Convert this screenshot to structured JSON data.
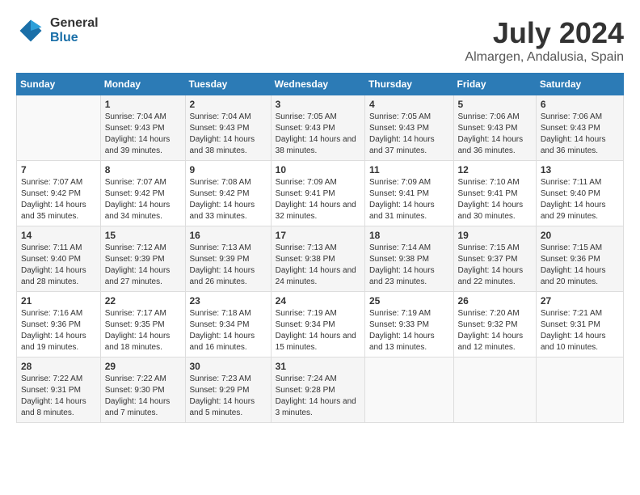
{
  "logo": {
    "line1": "General",
    "line2": "Blue"
  },
  "title": "July 2024",
  "location": "Almargen, Andalusia, Spain",
  "days_header": [
    "Sunday",
    "Monday",
    "Tuesday",
    "Wednesday",
    "Thursday",
    "Friday",
    "Saturday"
  ],
  "weeks": [
    [
      {
        "day": "",
        "sunrise": "",
        "sunset": "",
        "daylight": ""
      },
      {
        "day": "1",
        "sunrise": "Sunrise: 7:04 AM",
        "sunset": "Sunset: 9:43 PM",
        "daylight": "Daylight: 14 hours and 39 minutes."
      },
      {
        "day": "2",
        "sunrise": "Sunrise: 7:04 AM",
        "sunset": "Sunset: 9:43 PM",
        "daylight": "Daylight: 14 hours and 38 minutes."
      },
      {
        "day": "3",
        "sunrise": "Sunrise: 7:05 AM",
        "sunset": "Sunset: 9:43 PM",
        "daylight": "Daylight: 14 hours and 38 minutes."
      },
      {
        "day": "4",
        "sunrise": "Sunrise: 7:05 AM",
        "sunset": "Sunset: 9:43 PM",
        "daylight": "Daylight: 14 hours and 37 minutes."
      },
      {
        "day": "5",
        "sunrise": "Sunrise: 7:06 AM",
        "sunset": "Sunset: 9:43 PM",
        "daylight": "Daylight: 14 hours and 36 minutes."
      },
      {
        "day": "6",
        "sunrise": "Sunrise: 7:06 AM",
        "sunset": "Sunset: 9:43 PM",
        "daylight": "Daylight: 14 hours and 36 minutes."
      }
    ],
    [
      {
        "day": "7",
        "sunrise": "Sunrise: 7:07 AM",
        "sunset": "Sunset: 9:42 PM",
        "daylight": "Daylight: 14 hours and 35 minutes."
      },
      {
        "day": "8",
        "sunrise": "Sunrise: 7:07 AM",
        "sunset": "Sunset: 9:42 PM",
        "daylight": "Daylight: 14 hours and 34 minutes."
      },
      {
        "day": "9",
        "sunrise": "Sunrise: 7:08 AM",
        "sunset": "Sunset: 9:42 PM",
        "daylight": "Daylight: 14 hours and 33 minutes."
      },
      {
        "day": "10",
        "sunrise": "Sunrise: 7:09 AM",
        "sunset": "Sunset: 9:41 PM",
        "daylight": "Daylight: 14 hours and 32 minutes."
      },
      {
        "day": "11",
        "sunrise": "Sunrise: 7:09 AM",
        "sunset": "Sunset: 9:41 PM",
        "daylight": "Daylight: 14 hours and 31 minutes."
      },
      {
        "day": "12",
        "sunrise": "Sunrise: 7:10 AM",
        "sunset": "Sunset: 9:41 PM",
        "daylight": "Daylight: 14 hours and 30 minutes."
      },
      {
        "day": "13",
        "sunrise": "Sunrise: 7:11 AM",
        "sunset": "Sunset: 9:40 PM",
        "daylight": "Daylight: 14 hours and 29 minutes."
      }
    ],
    [
      {
        "day": "14",
        "sunrise": "Sunrise: 7:11 AM",
        "sunset": "Sunset: 9:40 PM",
        "daylight": "Daylight: 14 hours and 28 minutes."
      },
      {
        "day": "15",
        "sunrise": "Sunrise: 7:12 AM",
        "sunset": "Sunset: 9:39 PM",
        "daylight": "Daylight: 14 hours and 27 minutes."
      },
      {
        "day": "16",
        "sunrise": "Sunrise: 7:13 AM",
        "sunset": "Sunset: 9:39 PM",
        "daylight": "Daylight: 14 hours and 26 minutes."
      },
      {
        "day": "17",
        "sunrise": "Sunrise: 7:13 AM",
        "sunset": "Sunset: 9:38 PM",
        "daylight": "Daylight: 14 hours and 24 minutes."
      },
      {
        "day": "18",
        "sunrise": "Sunrise: 7:14 AM",
        "sunset": "Sunset: 9:38 PM",
        "daylight": "Daylight: 14 hours and 23 minutes."
      },
      {
        "day": "19",
        "sunrise": "Sunrise: 7:15 AM",
        "sunset": "Sunset: 9:37 PM",
        "daylight": "Daylight: 14 hours and 22 minutes."
      },
      {
        "day": "20",
        "sunrise": "Sunrise: 7:15 AM",
        "sunset": "Sunset: 9:36 PM",
        "daylight": "Daylight: 14 hours and 20 minutes."
      }
    ],
    [
      {
        "day": "21",
        "sunrise": "Sunrise: 7:16 AM",
        "sunset": "Sunset: 9:36 PM",
        "daylight": "Daylight: 14 hours and 19 minutes."
      },
      {
        "day": "22",
        "sunrise": "Sunrise: 7:17 AM",
        "sunset": "Sunset: 9:35 PM",
        "daylight": "Daylight: 14 hours and 18 minutes."
      },
      {
        "day": "23",
        "sunrise": "Sunrise: 7:18 AM",
        "sunset": "Sunset: 9:34 PM",
        "daylight": "Daylight: 14 hours and 16 minutes."
      },
      {
        "day": "24",
        "sunrise": "Sunrise: 7:19 AM",
        "sunset": "Sunset: 9:34 PM",
        "daylight": "Daylight: 14 hours and 15 minutes."
      },
      {
        "day": "25",
        "sunrise": "Sunrise: 7:19 AM",
        "sunset": "Sunset: 9:33 PM",
        "daylight": "Daylight: 14 hours and 13 minutes."
      },
      {
        "day": "26",
        "sunrise": "Sunrise: 7:20 AM",
        "sunset": "Sunset: 9:32 PM",
        "daylight": "Daylight: 14 hours and 12 minutes."
      },
      {
        "day": "27",
        "sunrise": "Sunrise: 7:21 AM",
        "sunset": "Sunset: 9:31 PM",
        "daylight": "Daylight: 14 hours and 10 minutes."
      }
    ],
    [
      {
        "day": "28",
        "sunrise": "Sunrise: 7:22 AM",
        "sunset": "Sunset: 9:31 PM",
        "daylight": "Daylight: 14 hours and 8 minutes."
      },
      {
        "day": "29",
        "sunrise": "Sunrise: 7:22 AM",
        "sunset": "Sunset: 9:30 PM",
        "daylight": "Daylight: 14 hours and 7 minutes."
      },
      {
        "day": "30",
        "sunrise": "Sunrise: 7:23 AM",
        "sunset": "Sunset: 9:29 PM",
        "daylight": "Daylight: 14 hours and 5 minutes."
      },
      {
        "day": "31",
        "sunrise": "Sunrise: 7:24 AM",
        "sunset": "Sunset: 9:28 PM",
        "daylight": "Daylight: 14 hours and 3 minutes."
      },
      {
        "day": "",
        "sunrise": "",
        "sunset": "",
        "daylight": ""
      },
      {
        "day": "",
        "sunrise": "",
        "sunset": "",
        "daylight": ""
      },
      {
        "day": "",
        "sunrise": "",
        "sunset": "",
        "daylight": ""
      }
    ]
  ]
}
